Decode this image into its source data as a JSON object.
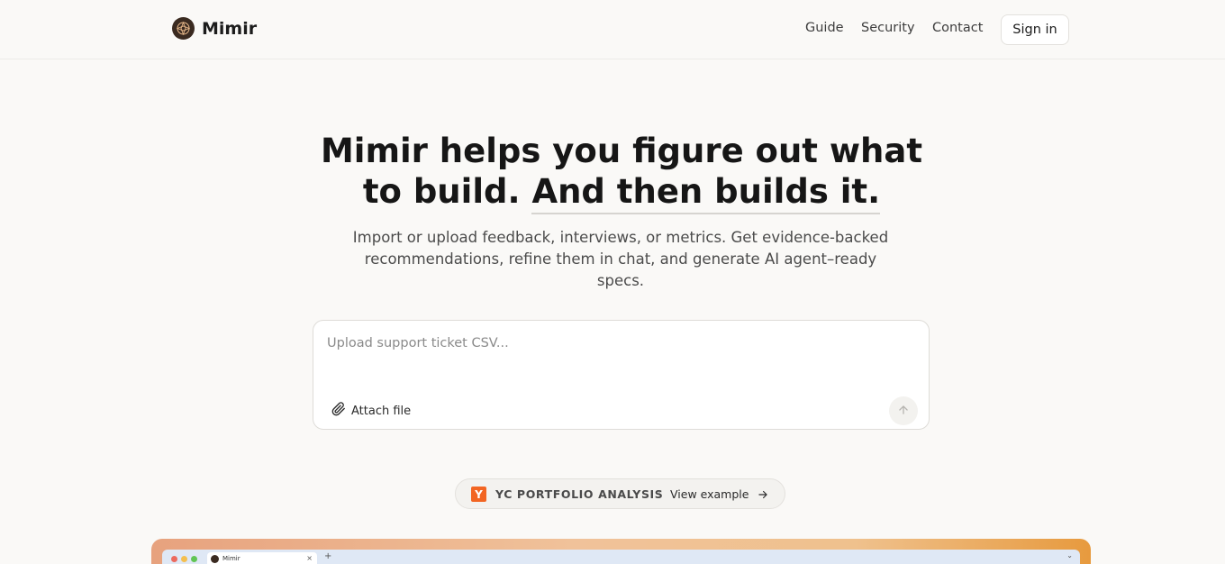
{
  "header": {
    "brand": "Mimir",
    "nav": {
      "guide": "Guide",
      "security": "Security",
      "contact": "Contact"
    },
    "sign_in": "Sign in"
  },
  "hero": {
    "title_part1": "Mimir helps you figure out what to build.",
    "title_part2": "And then builds it.",
    "subtitle": "Import or upload feedback, interviews, or metrics. Get evidence-backed recommendations, refine them in chat, and generate AI agent–ready specs."
  },
  "composer": {
    "placeholder": "Upload support ticket CSV...",
    "value": "",
    "attach_label": "Attach file"
  },
  "example_pill": {
    "badge": "Y",
    "label": "YC PORTFOLIO ANALYSIS",
    "separator": "·",
    "link": "View example"
  },
  "preview": {
    "tab_title": "Mimir",
    "tab_close": "×",
    "new_tab": "+",
    "chevron": "⌄"
  },
  "colors": {
    "background": "#faf9f7",
    "yc_orange": "#f26522",
    "text_primary": "#161616"
  }
}
